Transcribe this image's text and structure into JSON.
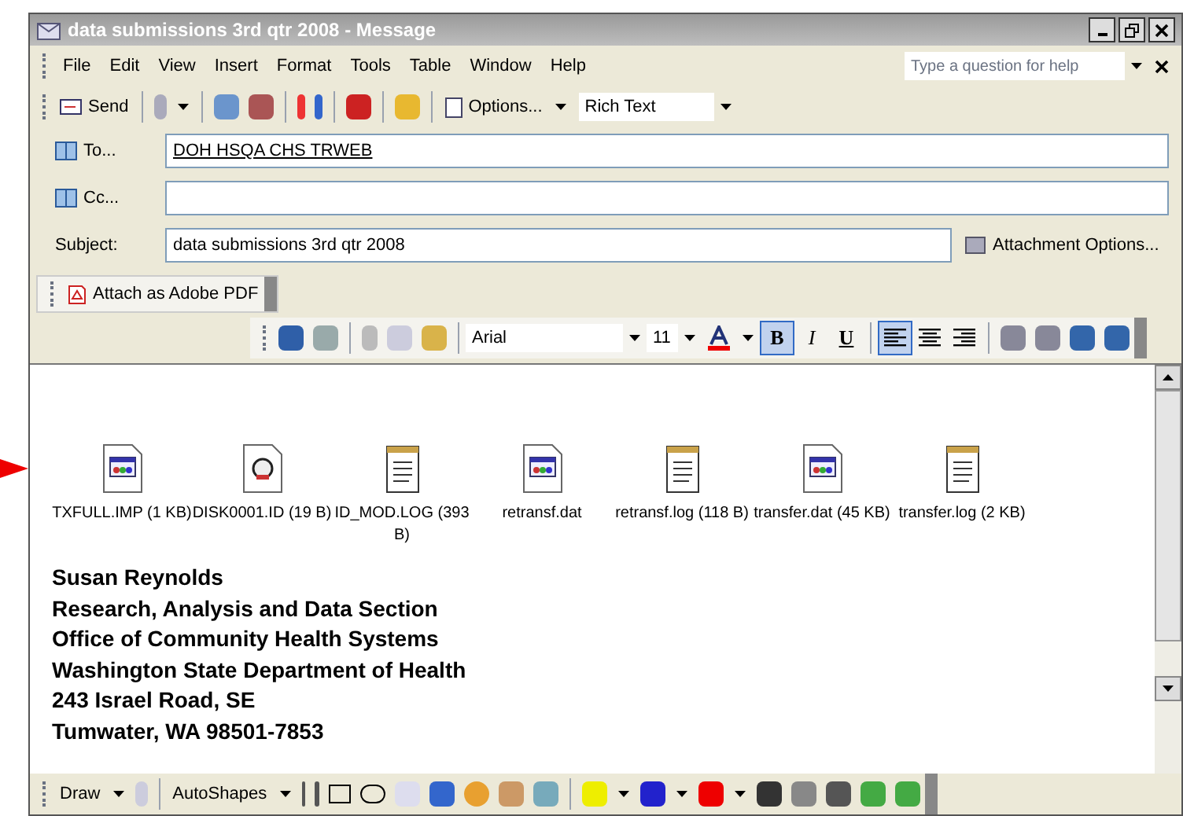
{
  "window": {
    "title": "data submissions 3rd qtr 2008 - Message"
  },
  "menu": [
    "File",
    "Edit",
    "View",
    "Insert",
    "Format",
    "Tools",
    "Table",
    "Window",
    "Help"
  ],
  "help": {
    "placeholder": "Type a question for help"
  },
  "toolbar": {
    "send": "Send",
    "options": "Options...",
    "format": "Rich Text"
  },
  "address": [
    {
      "kind": "book",
      "label": "To...",
      "value": "DOH HSQA CHS TRWEB"
    },
    {
      "kind": "book",
      "label": "Cc..."
    },
    {
      "kind": "plain",
      "label": "Subject:",
      "value": "data submissions 3rd qtr 2008"
    }
  ],
  "attachment_options": "Attachment Options...",
  "pdf_toolbar": {
    "label": "Attach as Adobe PDF"
  },
  "formatting": {
    "font": "Arial",
    "size": "11",
    "styles": [
      {
        "label": "B",
        "selected": true
      },
      {
        "label": "I",
        "selected": false
      },
      {
        "label": "U",
        "selected": false
      }
    ],
    "align": [
      {
        "kind": "left",
        "selected": true
      },
      {
        "kind": "center",
        "selected": false
      },
      {
        "kind": "right",
        "selected": false
      }
    ]
  },
  "attachments": [
    {
      "kind": "app",
      "name": "TXFULL.IMP (1 KB)"
    },
    {
      "kind": "script",
      "name": "DISK0001.ID (19 B)"
    },
    {
      "kind": "note",
      "name": "ID_MOD.LOG (393 B)"
    },
    {
      "kind": "app",
      "name": "retransf.dat"
    },
    {
      "kind": "note",
      "name": "retransf.log (118 B)"
    },
    {
      "kind": "app",
      "name": "transfer.dat (45 KB)"
    },
    {
      "kind": "note",
      "name": "transfer.log (2 KB)"
    }
  ],
  "signature": [
    "Susan Reynolds",
    "Research, Analysis and Data Section",
    "Office of Community Health Systems",
    "Washington State Department of Health",
    "243 Israel Road, SE",
    "Tumwater, WA 98501-7853"
  ],
  "draw_toolbar": {
    "draw": "Draw",
    "autoshapes": "AutoShapes"
  }
}
